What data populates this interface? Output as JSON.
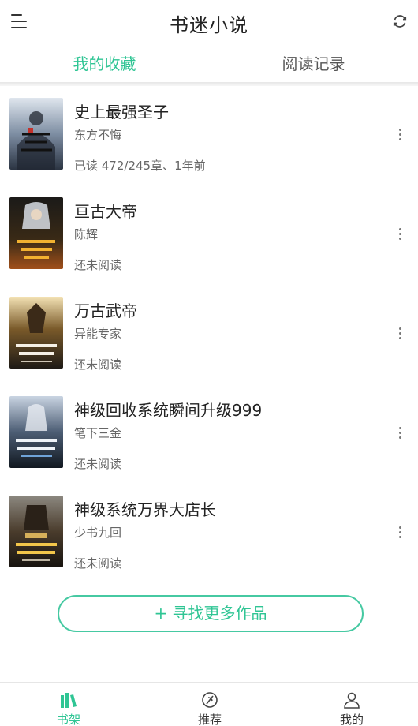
{
  "header": {
    "title": "书迷小说",
    "menu_icon": "menu-icon",
    "refresh_icon": "refresh-icon"
  },
  "tabs": [
    {
      "label": "我的收藏",
      "active": true
    },
    {
      "label": "阅读记录",
      "active": false
    }
  ],
  "books": [
    {
      "title": "史上最强圣子",
      "author": "东方不悔",
      "status": "已读 472/245章、1年前"
    },
    {
      "title": "亘古大帝",
      "author": "陈辉",
      "status": "还未阅读"
    },
    {
      "title": "万古武帝",
      "author": "异能专家",
      "status": "还未阅读"
    },
    {
      "title": "神级回收系统瞬间升级999",
      "author": "笔下三金",
      "status": "还未阅读"
    },
    {
      "title": "神级系统万界大店长",
      "author": "少书九回",
      "status": "还未阅读"
    }
  ],
  "find_more_label": "+ 寻找更多作品",
  "bottom_nav": [
    {
      "label": "书架",
      "icon": "bookshelf-icon",
      "active": true
    },
    {
      "label": "推荐",
      "icon": "recommend-icon",
      "active": false
    },
    {
      "label": "我的",
      "icon": "profile-icon",
      "active": false
    }
  ],
  "colors": {
    "accent": "#2fc594",
    "text_primary": "#222222",
    "text_secondary": "#666666"
  }
}
